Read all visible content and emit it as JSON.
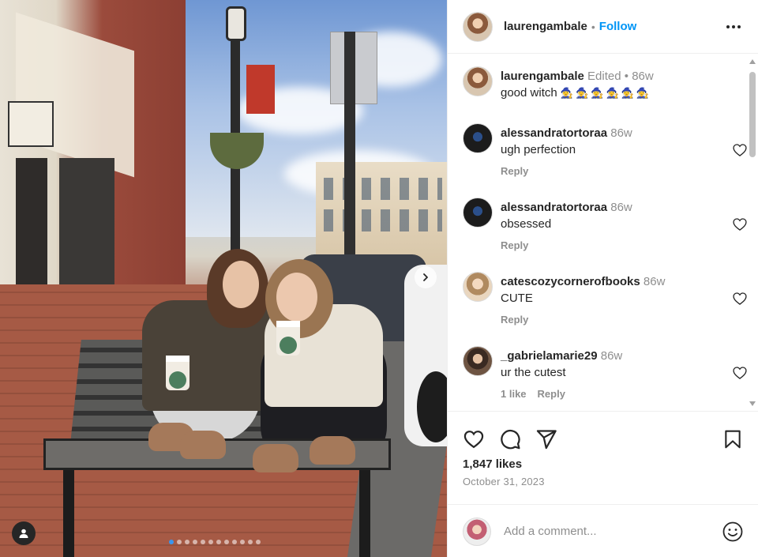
{
  "post": {
    "username": "laurengambale",
    "separator": "•",
    "follow_label": "Follow",
    "caption": {
      "username": "laurengambale",
      "edited": "Edited",
      "dot": "•",
      "age": "86w",
      "text": "good witch",
      "emojis": "🧙‍♀️🧙‍♀️🧙‍♀️🧙‍♀️🧙‍♀️🧙‍♀️"
    },
    "likes": "1,847 likes",
    "date": "October 31, 2023",
    "add_comment_placeholder": "Add a comment..."
  },
  "comments": [
    {
      "username": "alessandratortoraa",
      "age": "86w",
      "text": "ugh perfection",
      "reply": "Reply",
      "likes": ""
    },
    {
      "username": "alessandratortoraa",
      "age": "86w",
      "text": "obsessed",
      "reply": "Reply",
      "likes": ""
    },
    {
      "username": "catescozycornerofbooks",
      "age": "86w",
      "text": "CUTE",
      "reply": "Reply",
      "likes": ""
    },
    {
      "username": "_gabrielamarie29",
      "age": "86w",
      "text": "ur the cutest",
      "reply": "Reply",
      "likes": "1 like"
    }
  ],
  "carousel": {
    "count": 12,
    "active_index": 0
  },
  "icons": {
    "more": "more-horizontal-icon",
    "heart": "heart-icon",
    "comment": "comment-icon",
    "share": "share-icon",
    "save": "bookmark-icon",
    "emoji": "emoji-smile-icon",
    "next": "chevron-right-icon",
    "tag": "user-tag-icon"
  },
  "colors": {
    "link": "#0095f6",
    "muted": "#8e8e8e",
    "text": "#262626"
  }
}
